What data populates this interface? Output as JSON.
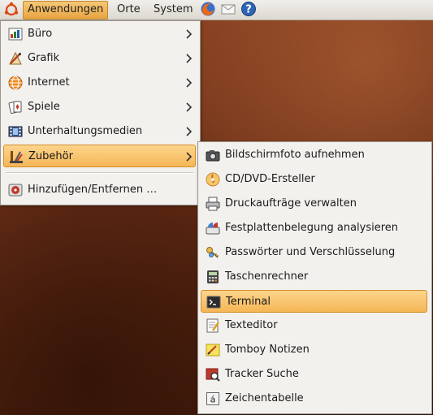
{
  "panel": {
    "menus": [
      "Anwendungen",
      "Orte",
      "System"
    ],
    "launchers": [
      "firefox-icon",
      "mail-icon",
      "help-icon"
    ]
  },
  "apps_menu": {
    "items": [
      {
        "label": "Büro",
        "icon": "office-icon",
        "submenu": true
      },
      {
        "label": "Grafik",
        "icon": "graphics-icon",
        "submenu": true
      },
      {
        "label": "Internet",
        "icon": "internet-icon",
        "submenu": true
      },
      {
        "label": "Spiele",
        "icon": "games-icon",
        "submenu": true
      },
      {
        "label": "Unterhaltungsmedien",
        "icon": "multimedia-icon",
        "submenu": true
      },
      {
        "label": "Zubehör",
        "icon": "accessories-icon",
        "submenu": true,
        "highlighted": true
      },
      {
        "label": "Hinzufügen/Entfernen …",
        "icon": "add-remove-icon",
        "submenu": false
      }
    ]
  },
  "accessories_menu": {
    "items": [
      {
        "label": "Bildschirmfoto aufnehmen",
        "icon": "camera-icon"
      },
      {
        "label": "CD/DVD-Ersteller",
        "icon": "disc-burner-icon"
      },
      {
        "label": "Druckaufträge verwalten",
        "icon": "printer-icon"
      },
      {
        "label": "Festplattenbelegung analysieren",
        "icon": "disk-usage-icon"
      },
      {
        "label": "Passwörter und Verschlüsselung",
        "icon": "keys-icon"
      },
      {
        "label": "Taschenrechner",
        "icon": "calculator-icon"
      },
      {
        "label": "Terminal",
        "icon": "terminal-icon",
        "highlighted": true
      },
      {
        "label": "Texteditor",
        "icon": "text-editor-icon"
      },
      {
        "label": "Tomboy Notizen",
        "icon": "notes-icon"
      },
      {
        "label": "Tracker Suche",
        "icon": "search-tool-icon"
      },
      {
        "label": "Zeichentabelle",
        "icon": "character-map-icon"
      }
    ]
  },
  "colors": {
    "highlight": "#f5b656",
    "desktop": "#6e3018"
  }
}
